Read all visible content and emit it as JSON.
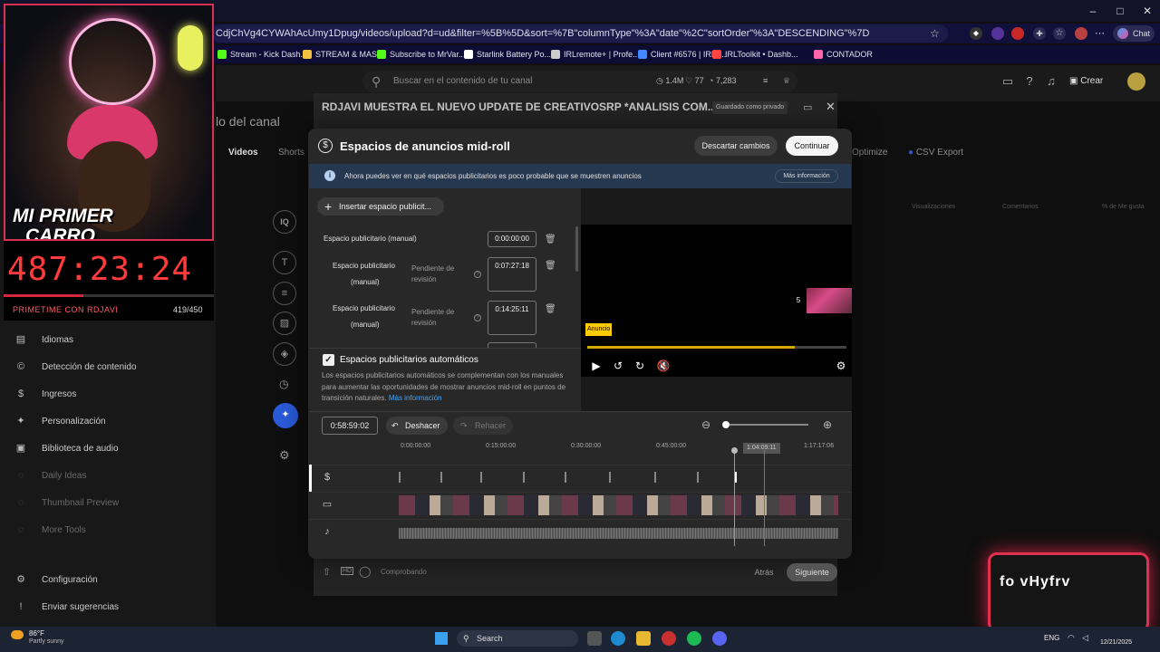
{
  "browser": {
    "url": "CdjChVg4CYWAhAcUmy1Dpug/videos/upload?d=ud&filter=%5B%5D&sort=%7B\"columnType\"%3A\"date\"%2C\"sortOrder\"%3A\"DESCENDING\"%7D",
    "gemini_label": "Chat",
    "bookmarks": [
      "Stream - Kick Dash...",
      "STREAM & MAS",
      "Subscribe to MrVar...",
      "Starlink Battery Po...",
      "IRLremote+ | Profe...",
      "Client #6576 | IRLT...",
      "IRLToolkit • Dashb...",
      "CONTADOR"
    ],
    "bookmark_colors": [
      "#53fc18",
      "#f0c040",
      "#53fc18",
      "#ffffff",
      "#cccccc",
      "#4488ff",
      "#ff4444",
      "#ff66aa"
    ]
  },
  "studio": {
    "search_placeholder": "Buscar en el contenido de tu canal",
    "stats": [
      "1.4M",
      "77",
      "7,283"
    ],
    "create_label": "Crear",
    "page_title_fragment": "lo del canal",
    "tabs": [
      "Videos",
      "Shorts"
    ],
    "right_tabs": [
      "Optimize",
      "CSV Export"
    ],
    "columns": [
      "Visualizaciones",
      "Comentarios",
      "% de Me gusta"
    ],
    "sidebar": [
      {
        "icon": "translate-icon",
        "glyph": "▤",
        "label": "Idiomas",
        "dim": false
      },
      {
        "icon": "copyright-icon",
        "glyph": "©",
        "label": "Detección de contenido",
        "dim": false
      },
      {
        "icon": "dollar-icon",
        "glyph": "$",
        "label": "Ingresos",
        "dim": false
      },
      {
        "icon": "magic-wand-icon",
        "glyph": "✦",
        "label": "Personalización",
        "dim": false
      },
      {
        "icon": "audio-library-icon",
        "glyph": "▣",
        "label": "Biblioteca de audio",
        "dim": false
      },
      {
        "icon": "ideas-icon",
        "glyph": "◌",
        "label": "Daily Ideas",
        "dim": true
      },
      {
        "icon": "thumbnail-icon",
        "glyph": "◌",
        "label": "Thumbnail Preview",
        "dim": true
      },
      {
        "icon": "tools-icon",
        "glyph": "◌",
        "label": "More Tools",
        "dim": true
      }
    ],
    "settings_label": "Configuración",
    "feedback_label": "Enviar sugerencias"
  },
  "details": {
    "title": "RDJAVI MUESTRA EL NUEVO UPDATE DE CREATIVOSRP *ANALISIS COM...",
    "saved_badge": "Guardado como privado",
    "checking_label": "Comprobando",
    "back_label": "Atrás",
    "next_label": "Siguiente"
  },
  "midroll": {
    "title": "Espacios de anuncios mid-roll",
    "discard_label": "Descartar cambios",
    "continue_label": "Continuar",
    "info_text": "Ahora puedes ver en qué espacios publicitarios es poco probable que se muestren anuncios",
    "more_info_label": "Más información",
    "insert_label": "Insertar espacio publicit...",
    "slot1_label": "Espacio publicitario (manual)",
    "slot1_time": "0:00:00:00",
    "slot2_label_a": "Espacio publicitario",
    "slot2_label_b": "(manual)",
    "slot2_pending_a": "Pendiente de",
    "slot2_pending_b": "revisión",
    "slot2_time": "0:07:27:18",
    "slot3_label_a": "Espacio publicitario",
    "slot3_label_b": "(manual)",
    "slot3_pending_a": "Pendiente de",
    "slot3_pending_b": "revisión",
    "slot3_time": "0:14:25:11",
    "auto_title": "Espacios publicitarios automáticos",
    "auto_desc": "Los espacios publicitarios automáticos se complementan con los manuales para aumentar las oportunidades de mostrar anuncios mid-roll en puntos de transición naturales.",
    "auto_link": "Más información"
  },
  "preview": {
    "ad_label": "Anuncio",
    "ad_countdown": "5",
    "ad_progress": 0.8
  },
  "timeline": {
    "current_time": "0:58:59:02",
    "undo_label": "Deshacer",
    "redo_label": "Rehacer",
    "ticks": [
      "0:00:00:00",
      "0:15:00:00",
      "0:30:00:00",
      "0:45:00:00",
      "1:17:17:06"
    ],
    "playhead_label": "1:04:09:11"
  },
  "webcam": {
    "sticker_line1": "MI PRIMER",
    "sticker_line2": "CARRO",
    "counter": "487:23:24",
    "stream_name": "PRIMETIME CON RDJAVI",
    "stream_count": "419/450",
    "progress": 0.38
  },
  "overlay": {
    "text": "fo vHyfrv"
  },
  "taskbar": {
    "temperature": "86°F",
    "weather": "Partly sunny",
    "search_label": "Search",
    "language": "ENG",
    "date": "12/21/2025"
  }
}
